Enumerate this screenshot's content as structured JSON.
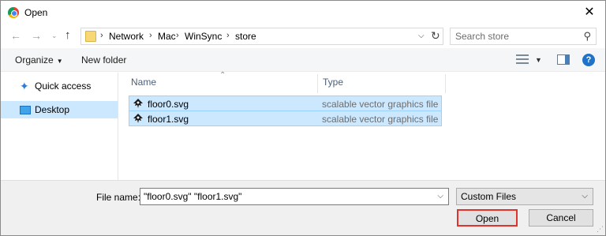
{
  "window": {
    "title": "Open",
    "close_glyph": "✕"
  },
  "nav": {
    "back_glyph": "←",
    "forward_glyph": "→",
    "recent_glyph": "⌄",
    "up_glyph": "↑",
    "breadcrumb": [
      "Network",
      "Mac",
      "WinSync",
      "store"
    ],
    "search_placeholder": "Search store"
  },
  "toolbar": {
    "organize_label": "Organize",
    "new_folder_label": "New folder",
    "help_glyph": "?"
  },
  "sidebar": {
    "items": [
      {
        "label": "Quick access",
        "icon": "star-icon",
        "selected": false
      },
      {
        "label": "Desktop",
        "icon": "desktop-icon",
        "selected": true
      }
    ]
  },
  "file_list": {
    "columns": [
      {
        "label": "Name",
        "sorted": "ascending"
      },
      {
        "label": "Type"
      }
    ],
    "rows": [
      {
        "name": "floor0.svg",
        "type": "scalable vector graphics file",
        "icon": "inkscape-file-icon",
        "selected": true
      },
      {
        "name": "floor1.svg",
        "type": "scalable vector graphics file",
        "icon": "inkscape-file-icon",
        "selected": true
      }
    ]
  },
  "bottom": {
    "file_name_label": "File name:",
    "file_name_value": "\"floor0.svg\" \"floor1.svg\"",
    "file_type_value": "Custom Files",
    "open_label": "Open",
    "cancel_label": "Cancel"
  },
  "colors": {
    "selection": "#cce8ff",
    "selection_border": "#99d1ff",
    "highlight_outline": "#e0332b",
    "help_blue": "#1e73c8"
  }
}
